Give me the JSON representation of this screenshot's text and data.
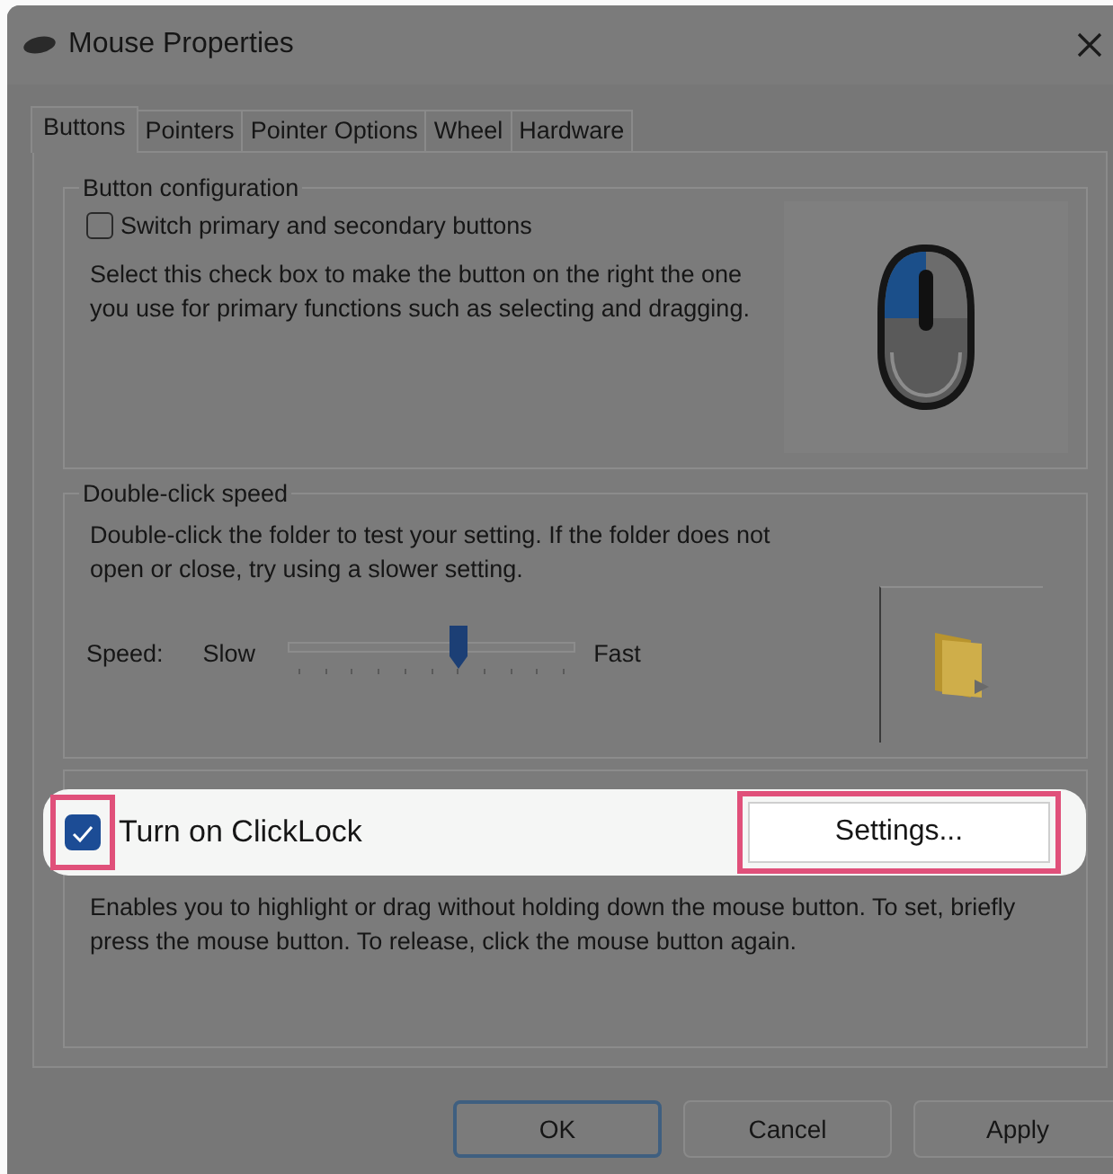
{
  "window": {
    "title": "Mouse Properties"
  },
  "tabs": [
    {
      "label": "Buttons",
      "selected": true
    },
    {
      "label": "Pointers",
      "selected": false
    },
    {
      "label": "Pointer Options",
      "selected": false
    },
    {
      "label": "Wheel",
      "selected": false
    },
    {
      "label": "Hardware",
      "selected": false
    }
  ],
  "button_configuration": {
    "title": "Button configuration",
    "checkbox": {
      "label": "Switch primary and secondary buttons",
      "checked": false
    },
    "description": "Select this check box to make the button on the right the one you use for primary functions such as selecting and dragging."
  },
  "double_click_speed": {
    "title": "Double-click speed",
    "description": "Double-click the folder to test your setting. If the folder does not open or close, try using a slower setting.",
    "speed_label": "Speed:",
    "slow_label": "Slow",
    "fast_label": "Fast",
    "slider": {
      "level": 0.6
    }
  },
  "clicklock": {
    "highlighted": true,
    "checkbox": {
      "label": "Turn on ClickLock",
      "checked": true
    },
    "settings_button": "Settings...",
    "description": "Enables you to highlight or drag without holding down the mouse button. To set, briefly press the mouse button. To release, click the mouse button again."
  },
  "buttons": [
    {
      "label": "OK",
      "default": true
    },
    {
      "label": "Cancel",
      "default": false
    },
    {
      "label": "Apply",
      "default": false
    }
  ]
}
